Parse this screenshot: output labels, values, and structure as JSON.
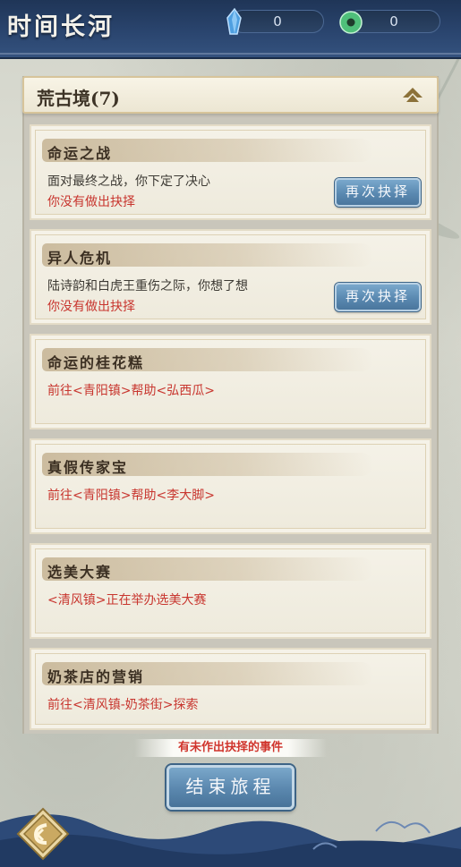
{
  "header": {
    "title": "时间长河",
    "currencies": [
      {
        "icon": "blue-crystal-icon",
        "value": "0"
      },
      {
        "icon": "jade-coin-icon",
        "value": "0"
      }
    ]
  },
  "panel": {
    "title": "荒古境(7)"
  },
  "events": [
    {
      "title": "命运之战",
      "desc": "面对最终之战，你下定了决心",
      "status": "你没有做出抉择",
      "button": "再次抉择"
    },
    {
      "title": "异人危机",
      "desc": "陆诗韵和白虎王重伤之际，你想了想",
      "status": "你没有做出抉择",
      "button": "再次抉择"
    },
    {
      "title": "命运的桂花糕",
      "status": "前往<青阳镇>帮助<弘西瓜>"
    },
    {
      "title": "真假传家宝",
      "status": "前往<青阳镇>帮助<李大脚>"
    },
    {
      "title": "选美大赛",
      "status": "<清风镇>正在举办选美大赛"
    },
    {
      "title": "奶茶店的营销",
      "status": "前往<清风镇-奶茶街>探索"
    }
  ],
  "footer": {
    "notice": "有未作出抉择的事件",
    "end_button": "结束旅程"
  },
  "colors": {
    "header_bg": "#2b4670",
    "button_blue": "#5a89b1",
    "status_red": "#c8362f"
  }
}
